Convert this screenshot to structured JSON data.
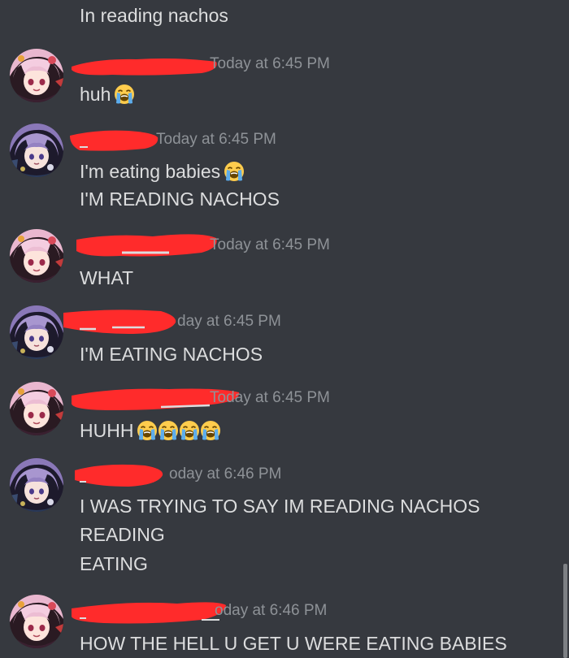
{
  "previous_line": "In reading nachos",
  "messages": [
    {
      "avatar": "pink-hair-avatar",
      "timestamp": "Today at 6:45 PM",
      "lines": [
        {
          "text": "huh",
          "emojis": 1
        }
      ]
    },
    {
      "avatar": "purple-hair-avatar",
      "timestamp": "Today at 6:45 PM",
      "lines": [
        {
          "text": "I'm eating babies",
          "emojis": 1
        },
        {
          "text": "I'M READING NACHOS",
          "emojis": 0
        }
      ]
    },
    {
      "avatar": "pink-hair-avatar",
      "timestamp": "Today at 6:45 PM",
      "lines": [
        {
          "text": "WHAT",
          "emojis": 0
        }
      ]
    },
    {
      "avatar": "purple-hair-avatar",
      "timestamp": "day at 6:45 PM",
      "lines": [
        {
          "text": "I'M EATING NACHOS",
          "emojis": 0
        }
      ]
    },
    {
      "avatar": "pink-hair-avatar",
      "timestamp": "Today at 6:45 PM",
      "lines": [
        {
          "text": "HUHH",
          "emojis": 4
        }
      ]
    },
    {
      "avatar": "purple-hair-avatar",
      "timestamp": "oday at 6:46 PM",
      "lines": [
        {
          "text": "I WAS TRYING TO SAY IM READING NACHOS",
          "emojis": 0
        },
        {
          "text": "READING",
          "emojis": 0
        },
        {
          "text": "EATING",
          "emojis": 0
        }
      ]
    },
    {
      "avatar": "pink-hair-avatar",
      "timestamp": "oday at 6:46 PM",
      "lines": [
        {
          "text": "HOW THE HELL U GET U WERE EATING BABIES",
          "emojis": 0
        }
      ]
    }
  ],
  "emoji_name": "loudly-crying-face-icon",
  "colors": {
    "background": "#36393f",
    "text": "#dcddde",
    "timestamp": "#8e9297",
    "redaction": "#ff2b2b",
    "emoji": "#ffcc4d"
  }
}
